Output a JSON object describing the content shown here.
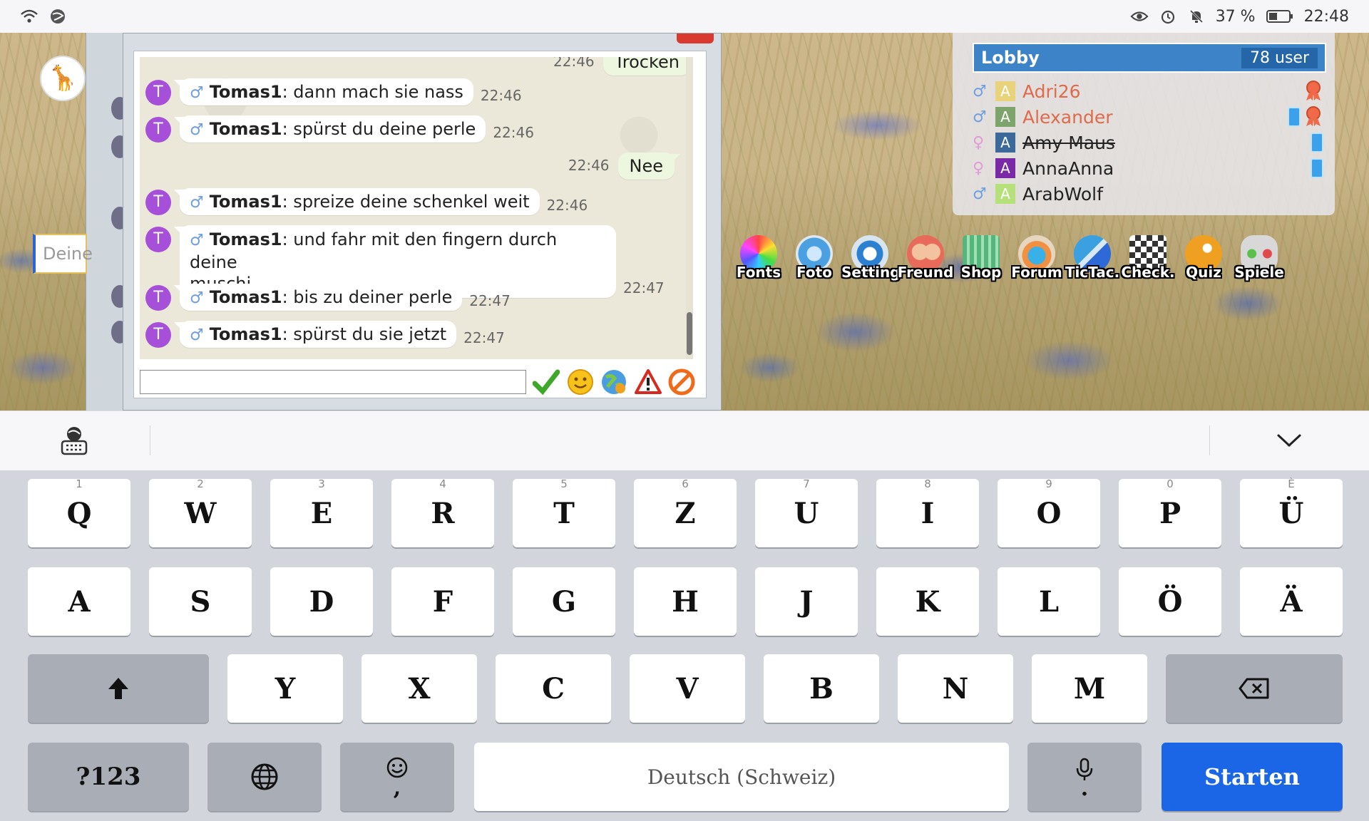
{
  "status": {
    "battery_percent": "37 %",
    "time": "22:48"
  },
  "left_window": {
    "input_placeholder": "Deine"
  },
  "chat": {
    "partial_top": {
      "time": "22:46",
      "text": "Trocken"
    },
    "messages": [
      {
        "avatar": "T",
        "nick": "Tomas1",
        "text": ": dann mach sie nass",
        "time": "22:46"
      },
      {
        "avatar": "T",
        "nick": "Tomas1",
        "text": ": spürst du deine perle",
        "time": "22:46"
      },
      {
        "avatar": "T",
        "nick": "Tomas1",
        "text": ": spreize deine schenkel weit",
        "time": "22:46"
      },
      {
        "avatar": "T",
        "nick": "Tomas1",
        "text": ": und fahr mit den fingern durch deine",
        "text2": "muschi",
        "time": "22:47"
      },
      {
        "avatar": "T",
        "nick": "Tomas1",
        "text": ": bis zu deiner perle",
        "time": "22:47"
      },
      {
        "avatar": "T",
        "nick": "Tomas1",
        "text": ": spürst du sie jetzt",
        "time": "22:47"
      }
    ],
    "own_message": {
      "text": "Nee",
      "time": "22:46"
    },
    "input_value": ""
  },
  "lobby": {
    "title": "Lobby",
    "count": "78 user",
    "users": [
      {
        "letter": "A",
        "name": "Adri26",
        "gender": "male",
        "color": "#e8d27a",
        "name_color": "#e06a4a"
      },
      {
        "letter": "A",
        "name": "Alexander",
        "gender": "male",
        "color": "#7da46a",
        "name_color": "#e06a4a"
      },
      {
        "letter": "A",
        "name": "Amy Maus",
        "gender": "female",
        "color": "#3b6a9a",
        "name_color": "#222"
      },
      {
        "letter": "A",
        "name": "AnnaAnna",
        "gender": "female",
        "color": "#7a2aa6",
        "name_color": "#222"
      },
      {
        "letter": "A",
        "name": "ArabWolf",
        "gender": "male",
        "color": "#b6e07a",
        "name_color": "#222"
      }
    ]
  },
  "apps": [
    {
      "label": "Fonts",
      "color": "#f04fb0"
    },
    {
      "label": "Foto",
      "color": "#4aa0e0"
    },
    {
      "label": "Setting",
      "color": "#2d7fcf"
    },
    {
      "label": "Freund",
      "color": "#f0a060"
    },
    {
      "label": "Shop",
      "color": "#56b57a"
    },
    {
      "label": "Forum",
      "color": "#e08a40"
    },
    {
      "label": "TicTac.",
      "color": "#3aa0e0"
    },
    {
      "label": "Check.",
      "color": "#444444"
    },
    {
      "label": "Quiz",
      "color": "#f0a020"
    },
    {
      "label": "Spiele",
      "color": "#bbbbbb"
    }
  ],
  "keyboard": {
    "row1": [
      {
        "k": "Q",
        "n": "1"
      },
      {
        "k": "W",
        "n": "2"
      },
      {
        "k": "E",
        "n": "3"
      },
      {
        "k": "R",
        "n": "4"
      },
      {
        "k": "T",
        "n": "5"
      },
      {
        "k": "Z",
        "n": "6"
      },
      {
        "k": "U",
        "n": "7"
      },
      {
        "k": "I",
        "n": "8"
      },
      {
        "k": "O",
        "n": "9"
      },
      {
        "k": "P",
        "n": "0"
      },
      {
        "k": "Ü",
        "n": "È"
      }
    ],
    "row2": [
      "A",
      "S",
      "D",
      "F",
      "G",
      "H",
      "J",
      "K",
      "L",
      "Ö",
      "Ä"
    ],
    "row3": [
      "Y",
      "X",
      "C",
      "V",
      "B",
      "N",
      "M"
    ],
    "numbers_key": "?123",
    "comma_key": ",",
    "period_key": ".",
    "space_label": "Deutsch (Schweiz)",
    "enter_label": "Starten"
  },
  "colors": {
    "accent": "#1a66e6",
    "lobby_header": "#3d83c7",
    "avatar": "#a64fd9"
  }
}
